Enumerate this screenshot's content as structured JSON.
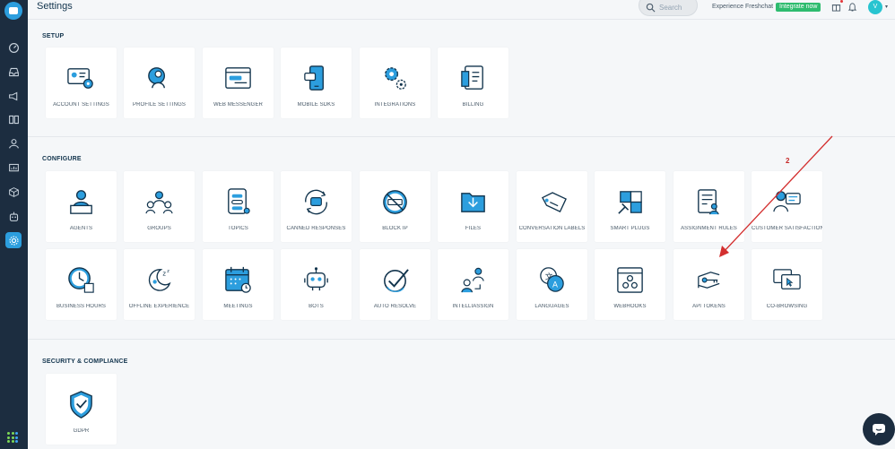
{
  "header": {
    "title": "Settings",
    "search_placeholder": "Search",
    "experience_text": "Experience Freshchat",
    "integrate_label": "Integrate now",
    "avatar_initial": "V"
  },
  "sections": {
    "setup": "SETUP",
    "configure": "CONFIGURE",
    "security": "SECURITY & COMPLIANCE"
  },
  "setup_tiles": [
    {
      "label": "ACCOUNT SETTINGS",
      "icon": "account-settings-icon"
    },
    {
      "label": "PROFILE SETTINGS",
      "icon": "profile-settings-icon"
    },
    {
      "label": "WEB MESSENGER",
      "icon": "web-messenger-icon"
    },
    {
      "label": "MOBILE SDKS",
      "icon": "mobile-sdks-icon"
    },
    {
      "label": "INTEGRATIONS",
      "icon": "integrations-icon"
    },
    {
      "label": "BILLING",
      "icon": "billing-icon"
    }
  ],
  "configure_tiles": [
    {
      "label": "AGENTS",
      "icon": "agents-icon"
    },
    {
      "label": "GROUPS",
      "icon": "groups-icon"
    },
    {
      "label": "TOPICS",
      "icon": "topics-icon"
    },
    {
      "label": "CANNED RESPONSES",
      "icon": "canned-responses-icon"
    },
    {
      "label": "BLOCK IP",
      "icon": "block-ip-icon"
    },
    {
      "label": "FILES",
      "icon": "files-icon"
    },
    {
      "label": "CONVERSATION LABELS",
      "icon": "conversation-labels-icon"
    },
    {
      "label": "SMART PLUGS",
      "icon": "smart-plugs-icon"
    },
    {
      "label": "ASSIGNMENT RULES",
      "icon": "assignment-rules-icon"
    },
    {
      "label": "CUSTOMER SATISFACTION",
      "icon": "customer-satisfaction-icon"
    },
    {
      "label": "BUSINESS HOURS",
      "icon": "business-hours-icon"
    },
    {
      "label": "OFFLINE EXPERIENCE",
      "icon": "offline-experience-icon"
    },
    {
      "label": "MEETINGS",
      "icon": "meetings-icon"
    },
    {
      "label": "BOTS",
      "icon": "bots-icon"
    },
    {
      "label": "AUTO RESOLVE",
      "icon": "auto-resolve-icon"
    },
    {
      "label": "INTELLIASSIGN",
      "icon": "intelliassign-icon"
    },
    {
      "label": "LANGUAGES",
      "icon": "languages-icon"
    },
    {
      "label": "WEBHOOKS",
      "icon": "webhooks-icon"
    },
    {
      "label": "API TOKENS",
      "icon": "api-tokens-icon"
    },
    {
      "label": "CO-BROWSING",
      "icon": "co-browsing-icon"
    }
  ],
  "security_tiles": [
    {
      "label": "GDPR",
      "icon": "gdpr-icon"
    }
  ],
  "annotation": {
    "number": "2",
    "color": "#c62828"
  },
  "colors": {
    "sidebar": "#1c2d40",
    "accent": "#2c9ede",
    "integrate": "#2ebc6f",
    "icon_dark": "#12344d"
  }
}
